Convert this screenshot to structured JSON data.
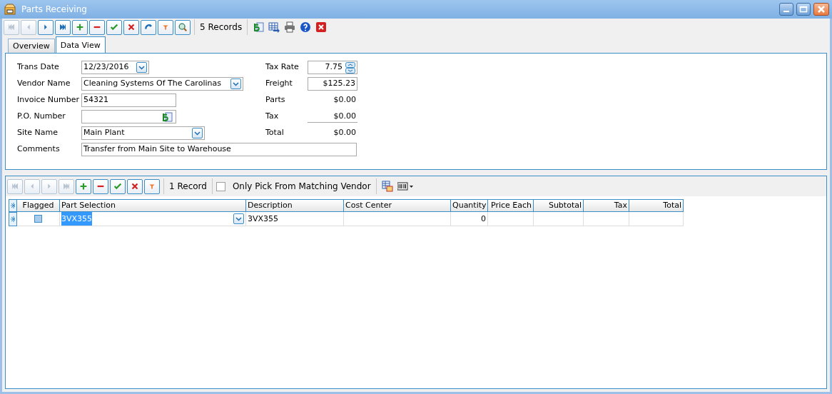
{
  "window": {
    "title": "Parts Receiving"
  },
  "toolbar": {
    "buttons": [
      {
        "kind": "first",
        "disabled": true
      },
      {
        "kind": "prev",
        "disabled": true
      },
      {
        "kind": "next",
        "disabled": false
      },
      {
        "kind": "last",
        "disabled": false
      },
      {
        "kind": "add",
        "disabled": false
      },
      {
        "kind": "delete",
        "disabled": false
      },
      {
        "kind": "save",
        "disabled": false
      },
      {
        "kind": "cancel",
        "disabled": false
      },
      {
        "kind": "refresh",
        "disabled": false
      },
      {
        "kind": "filter",
        "disabled": false
      },
      {
        "kind": "find",
        "disabled": false
      }
    ],
    "record_count": "5 Records",
    "tools": [
      {
        "kind": "money"
      },
      {
        "kind": "export"
      },
      {
        "kind": "print"
      },
      {
        "kind": "help"
      },
      {
        "kind": "close"
      }
    ]
  },
  "tabs": [
    {
      "label": "Overview",
      "selected": false
    },
    {
      "label": "Data View",
      "selected": true
    }
  ],
  "form": {
    "left": [
      {
        "label": "Trans Date",
        "kind": "date",
        "value": "12/23/2016"
      },
      {
        "label": "Vendor Name",
        "kind": "combo",
        "value": "Cleaning Systems Of The Carolinas"
      },
      {
        "label": "Invoice Number",
        "kind": "text",
        "value": "54321"
      },
      {
        "label": "P.O. Number",
        "kind": "lookup"
      },
      {
        "label": "Site Name",
        "kind": "combo",
        "value": "Main Plant"
      },
      {
        "label": "Comments",
        "kind": "wide",
        "value": "Transfer from Main Site to Warehouse"
      }
    ],
    "right": [
      {
        "label": "Tax Rate",
        "kind": "spin",
        "value": "7.75"
      },
      {
        "label": "Freight",
        "kind": "text",
        "value": "$125.23"
      },
      {
        "label": "Parts",
        "kind": "readonly",
        "value": "$0.00"
      },
      {
        "label": "Tax",
        "kind": "underlined",
        "value": "$0.00"
      },
      {
        "label": "Total",
        "kind": "readonly",
        "value": "$0.00"
      }
    ]
  },
  "detail_toolbar": {
    "buttons": [
      {
        "kind": "first",
        "disabled": true
      },
      {
        "kind": "prev",
        "disabled": true
      },
      {
        "kind": "next",
        "disabled": true
      },
      {
        "kind": "last",
        "disabled": true
      },
      {
        "kind": "add",
        "disabled": false
      },
      {
        "kind": "delete",
        "disabled": false
      },
      {
        "kind": "save",
        "disabled": false
      },
      {
        "kind": "cancel",
        "disabled": false
      },
      {
        "kind": "filter",
        "disabled": false
      }
    ],
    "record_count": "1 Record",
    "checkbox": {
      "label": "Only Pick From Matching Vendor",
      "checked": false
    },
    "tools": [
      {
        "kind": "grid"
      },
      {
        "kind": "barcode"
      }
    ]
  },
  "table": {
    "columns": [
      "Flagged",
      "Part Selection",
      "Description",
      "Cost Center",
      "Quantity",
      "Price Each",
      "Subtotal",
      "Tax",
      "Total"
    ],
    "rows": [
      {
        "flagged": false,
        "part": "3VX355",
        "part_selected": true,
        "description": "3VX355",
        "cost_center": "",
        "quantity": "0",
        "price_each": "",
        "subtotal": "",
        "tax": "",
        "total": ""
      }
    ]
  }
}
